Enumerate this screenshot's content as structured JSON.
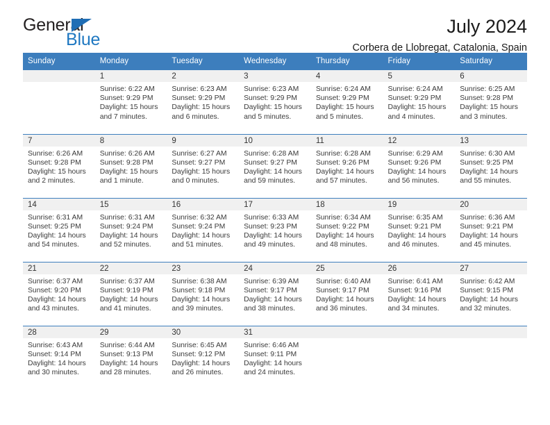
{
  "brand": {
    "name_part1": "General",
    "name_part2": "Blue",
    "triangle_icon": "triangle-icon",
    "color_dark": "#231f20",
    "color_blue": "#1f78c1"
  },
  "header": {
    "title": "July 2024",
    "subtitle": "Corbera de Llobregat, Catalonia, Spain"
  },
  "theme": {
    "header_bg": "#3d7ebd",
    "header_text": "#ffffff",
    "daynum_band_bg": "#f0f0f0",
    "row_divider": "#3d7ebd"
  },
  "calendar": {
    "weekday_headers": [
      "Sunday",
      "Monday",
      "Tuesday",
      "Wednesday",
      "Thursday",
      "Friday",
      "Saturday"
    ],
    "weeks": [
      [
        {
          "day": "",
          "empty": true,
          "sunrise": "",
          "sunset": "",
          "daylight_line1": "",
          "daylight_line2": ""
        },
        {
          "day": "1",
          "sunrise": "Sunrise: 6:22 AM",
          "sunset": "Sunset: 9:29 PM",
          "daylight_line1": "Daylight: 15 hours",
          "daylight_line2": "and 7 minutes."
        },
        {
          "day": "2",
          "sunrise": "Sunrise: 6:23 AM",
          "sunset": "Sunset: 9:29 PM",
          "daylight_line1": "Daylight: 15 hours",
          "daylight_line2": "and 6 minutes."
        },
        {
          "day": "3",
          "sunrise": "Sunrise: 6:23 AM",
          "sunset": "Sunset: 9:29 PM",
          "daylight_line1": "Daylight: 15 hours",
          "daylight_line2": "and 5 minutes."
        },
        {
          "day": "4",
          "sunrise": "Sunrise: 6:24 AM",
          "sunset": "Sunset: 9:29 PM",
          "daylight_line1": "Daylight: 15 hours",
          "daylight_line2": "and 5 minutes."
        },
        {
          "day": "5",
          "sunrise": "Sunrise: 6:24 AM",
          "sunset": "Sunset: 9:29 PM",
          "daylight_line1": "Daylight: 15 hours",
          "daylight_line2": "and 4 minutes."
        },
        {
          "day": "6",
          "sunrise": "Sunrise: 6:25 AM",
          "sunset": "Sunset: 9:28 PM",
          "daylight_line1": "Daylight: 15 hours",
          "daylight_line2": "and 3 minutes."
        }
      ],
      [
        {
          "day": "7",
          "sunrise": "Sunrise: 6:26 AM",
          "sunset": "Sunset: 9:28 PM",
          "daylight_line1": "Daylight: 15 hours",
          "daylight_line2": "and 2 minutes."
        },
        {
          "day": "8",
          "sunrise": "Sunrise: 6:26 AM",
          "sunset": "Sunset: 9:28 PM",
          "daylight_line1": "Daylight: 15 hours",
          "daylight_line2": "and 1 minute."
        },
        {
          "day": "9",
          "sunrise": "Sunrise: 6:27 AM",
          "sunset": "Sunset: 9:27 PM",
          "daylight_line1": "Daylight: 15 hours",
          "daylight_line2": "and 0 minutes."
        },
        {
          "day": "10",
          "sunrise": "Sunrise: 6:28 AM",
          "sunset": "Sunset: 9:27 PM",
          "daylight_line1": "Daylight: 14 hours",
          "daylight_line2": "and 59 minutes."
        },
        {
          "day": "11",
          "sunrise": "Sunrise: 6:28 AM",
          "sunset": "Sunset: 9:26 PM",
          "daylight_line1": "Daylight: 14 hours",
          "daylight_line2": "and 57 minutes."
        },
        {
          "day": "12",
          "sunrise": "Sunrise: 6:29 AM",
          "sunset": "Sunset: 9:26 PM",
          "daylight_line1": "Daylight: 14 hours",
          "daylight_line2": "and 56 minutes."
        },
        {
          "day": "13",
          "sunrise": "Sunrise: 6:30 AM",
          "sunset": "Sunset: 9:25 PM",
          "daylight_line1": "Daylight: 14 hours",
          "daylight_line2": "and 55 minutes."
        }
      ],
      [
        {
          "day": "14",
          "sunrise": "Sunrise: 6:31 AM",
          "sunset": "Sunset: 9:25 PM",
          "daylight_line1": "Daylight: 14 hours",
          "daylight_line2": "and 54 minutes."
        },
        {
          "day": "15",
          "sunrise": "Sunrise: 6:31 AM",
          "sunset": "Sunset: 9:24 PM",
          "daylight_line1": "Daylight: 14 hours",
          "daylight_line2": "and 52 minutes."
        },
        {
          "day": "16",
          "sunrise": "Sunrise: 6:32 AM",
          "sunset": "Sunset: 9:24 PM",
          "daylight_line1": "Daylight: 14 hours",
          "daylight_line2": "and 51 minutes."
        },
        {
          "day": "17",
          "sunrise": "Sunrise: 6:33 AM",
          "sunset": "Sunset: 9:23 PM",
          "daylight_line1": "Daylight: 14 hours",
          "daylight_line2": "and 49 minutes."
        },
        {
          "day": "18",
          "sunrise": "Sunrise: 6:34 AM",
          "sunset": "Sunset: 9:22 PM",
          "daylight_line1": "Daylight: 14 hours",
          "daylight_line2": "and 48 minutes."
        },
        {
          "day": "19",
          "sunrise": "Sunrise: 6:35 AM",
          "sunset": "Sunset: 9:21 PM",
          "daylight_line1": "Daylight: 14 hours",
          "daylight_line2": "and 46 minutes."
        },
        {
          "day": "20",
          "sunrise": "Sunrise: 6:36 AM",
          "sunset": "Sunset: 9:21 PM",
          "daylight_line1": "Daylight: 14 hours",
          "daylight_line2": "and 45 minutes."
        }
      ],
      [
        {
          "day": "21",
          "sunrise": "Sunrise: 6:37 AM",
          "sunset": "Sunset: 9:20 PM",
          "daylight_line1": "Daylight: 14 hours",
          "daylight_line2": "and 43 minutes."
        },
        {
          "day": "22",
          "sunrise": "Sunrise: 6:37 AM",
          "sunset": "Sunset: 9:19 PM",
          "daylight_line1": "Daylight: 14 hours",
          "daylight_line2": "and 41 minutes."
        },
        {
          "day": "23",
          "sunrise": "Sunrise: 6:38 AM",
          "sunset": "Sunset: 9:18 PM",
          "daylight_line1": "Daylight: 14 hours",
          "daylight_line2": "and 39 minutes."
        },
        {
          "day": "24",
          "sunrise": "Sunrise: 6:39 AM",
          "sunset": "Sunset: 9:17 PM",
          "daylight_line1": "Daylight: 14 hours",
          "daylight_line2": "and 38 minutes."
        },
        {
          "day": "25",
          "sunrise": "Sunrise: 6:40 AM",
          "sunset": "Sunset: 9:17 PM",
          "daylight_line1": "Daylight: 14 hours",
          "daylight_line2": "and 36 minutes."
        },
        {
          "day": "26",
          "sunrise": "Sunrise: 6:41 AM",
          "sunset": "Sunset: 9:16 PM",
          "daylight_line1": "Daylight: 14 hours",
          "daylight_line2": "and 34 minutes."
        },
        {
          "day": "27",
          "sunrise": "Sunrise: 6:42 AM",
          "sunset": "Sunset: 9:15 PM",
          "daylight_line1": "Daylight: 14 hours",
          "daylight_line2": "and 32 minutes."
        }
      ],
      [
        {
          "day": "28",
          "sunrise": "Sunrise: 6:43 AM",
          "sunset": "Sunset: 9:14 PM",
          "daylight_line1": "Daylight: 14 hours",
          "daylight_line2": "and 30 minutes."
        },
        {
          "day": "29",
          "sunrise": "Sunrise: 6:44 AM",
          "sunset": "Sunset: 9:13 PM",
          "daylight_line1": "Daylight: 14 hours",
          "daylight_line2": "and 28 minutes."
        },
        {
          "day": "30",
          "sunrise": "Sunrise: 6:45 AM",
          "sunset": "Sunset: 9:12 PM",
          "daylight_line1": "Daylight: 14 hours",
          "daylight_line2": "and 26 minutes."
        },
        {
          "day": "31",
          "sunrise": "Sunrise: 6:46 AM",
          "sunset": "Sunset: 9:11 PM",
          "daylight_line1": "Daylight: 14 hours",
          "daylight_line2": "and 24 minutes."
        },
        {
          "day": "",
          "empty": true,
          "sunrise": "",
          "sunset": "",
          "daylight_line1": "",
          "daylight_line2": ""
        },
        {
          "day": "",
          "empty": true,
          "sunrise": "",
          "sunset": "",
          "daylight_line1": "",
          "daylight_line2": ""
        },
        {
          "day": "",
          "empty": true,
          "sunrise": "",
          "sunset": "",
          "daylight_line1": "",
          "daylight_line2": ""
        }
      ]
    ]
  }
}
